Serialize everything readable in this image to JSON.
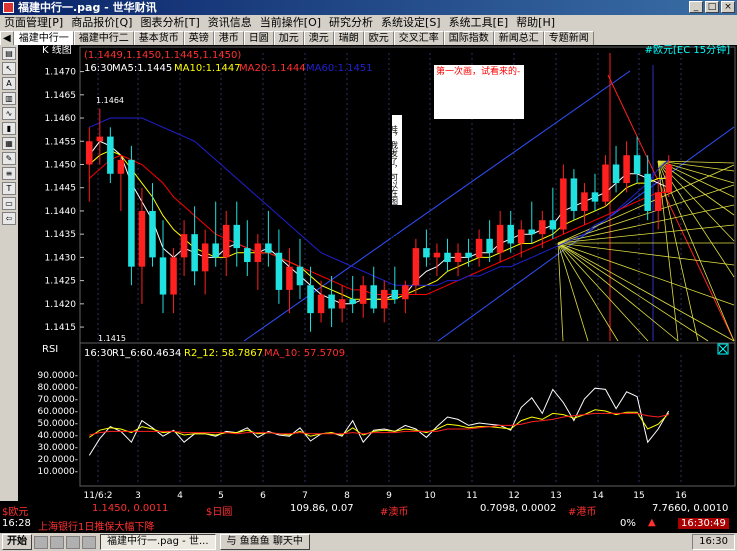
{
  "window": {
    "title": "福建中行一.pag - 世华财讯"
  },
  "menu": [
    "页面管理[P]",
    "商品报价[Q]",
    "图表分析[T]",
    "资讯信息",
    "当前操作[O]",
    "研究分析",
    "系统设定[S]",
    "系统工具[E]",
    "帮助[H]"
  ],
  "tabs": [
    "◀",
    "福建中行一",
    "福建中行二",
    "基本货币",
    "英镑",
    "港币",
    "日圆",
    "加元",
    "澳元",
    "瑞朗",
    "欧元",
    "交叉汇率",
    "国际指数",
    "新闻总汇",
    "专题新闻"
  ],
  "toolbar_icons": [
    "page-icon",
    "cursor-icon",
    "zoom-icon",
    "bar-chart-icon",
    "line-chart-icon",
    "candle-icon",
    "grid-icon",
    "pen-icon",
    "fib-icon",
    "text-icon",
    "print-icon",
    "exit-icon"
  ],
  "chart_data": [
    {
      "type": "candlestick",
      "title": "K 线图",
      "ohlc_header": "(1.1449,1.1450,1.1445,1.1450)",
      "time_label": "16:30",
      "ma_labels": [
        "MA5:1.1445",
        "MA10:1.1447",
        "MA20:1.1444",
        "MA60:1.1451"
      ],
      "symbol": "#欧元[EC 15分钟]",
      "annotations": [
        "1.1464",
        "1.1415",
        "第一次画，试看来的-",
        "哇，我发了，可以在图上画图也能写字..."
      ],
      "y_ticks": [
        "1.1470",
        "1.1465",
        "1.1460",
        "1.1455",
        "1.1450",
        "1.1445",
        "1.1440",
        "1.1435",
        "1.1430",
        "1.1425",
        "1.1420",
        "1.1415"
      ],
      "ylim": [
        1.1412,
        1.1474
      ],
      "x_ticks": [
        "11/6:2",
        "3",
        "4",
        "5",
        "6",
        "7",
        "8",
        "9",
        "10",
        "11",
        "12",
        "13",
        "14",
        "15",
        "16"
      ],
      "candles": [
        [
          1.145,
          1.1458,
          1.1442,
          1.1455
        ],
        [
          1.1455,
          1.1462,
          1.145,
          1.1456
        ],
        [
          1.1456,
          1.1458,
          1.1446,
          1.1448
        ],
        [
          1.1448,
          1.1452,
          1.144,
          1.1451
        ],
        [
          1.1451,
          1.1454,
          1.1424,
          1.1428
        ],
        [
          1.1428,
          1.1445,
          1.142,
          1.144
        ],
        [
          1.144,
          1.1446,
          1.1428,
          1.143
        ],
        [
          1.143,
          1.1438,
          1.1418,
          1.1422
        ],
        [
          1.1422,
          1.1432,
          1.1418,
          1.143
        ],
        [
          1.143,
          1.1438,
          1.1426,
          1.1435
        ],
        [
          1.1435,
          1.1441,
          1.1424,
          1.1427
        ],
        [
          1.1427,
          1.1436,
          1.1422,
          1.1433
        ],
        [
          1.1433,
          1.1442,
          1.1428,
          1.143
        ],
        [
          1.143,
          1.144,
          1.1426,
          1.1437
        ],
        [
          1.1437,
          1.1442,
          1.1428,
          1.1432
        ],
        [
          1.1432,
          1.1438,
          1.1426,
          1.1429
        ],
        [
          1.1429,
          1.1435,
          1.1423,
          1.1433
        ],
        [
          1.1433,
          1.144,
          1.1428,
          1.1431
        ],
        [
          1.1431,
          1.1436,
          1.142,
          1.1423
        ],
        [
          1.1423,
          1.1432,
          1.1418,
          1.1428
        ],
        [
          1.1428,
          1.1434,
          1.1421,
          1.1424
        ],
        [
          1.1424,
          1.1428,
          1.1414,
          1.1418
        ],
        [
          1.1418,
          1.1425,
          1.1416,
          1.1422
        ],
        [
          1.1422,
          1.1426,
          1.1415,
          1.1419
        ],
        [
          1.1419,
          1.1424,
          1.1416,
          1.1421
        ],
        [
          1.1421,
          1.1426,
          1.1418,
          1.142
        ],
        [
          1.142,
          1.1426,
          1.1417,
          1.1424
        ],
        [
          1.1424,
          1.1428,
          1.1418,
          1.1419
        ],
        [
          1.1419,
          1.1425,
          1.1416,
          1.1423
        ],
        [
          1.1423,
          1.1428,
          1.142,
          1.1421
        ],
        [
          1.1421,
          1.1425,
          1.1418,
          1.1424
        ],
        [
          1.1424,
          1.1434,
          1.1422,
          1.1432
        ],
        [
          1.1432,
          1.1436,
          1.1428,
          1.143
        ],
        [
          1.143,
          1.1433,
          1.1426,
          1.1431
        ],
        [
          1.1431,
          1.1434,
          1.1427,
          1.1429
        ],
        [
          1.1429,
          1.1433,
          1.1426,
          1.1431
        ],
        [
          1.1431,
          1.1434,
          1.1428,
          1.143
        ],
        [
          1.143,
          1.1436,
          1.1428,
          1.1434
        ],
        [
          1.1434,
          1.1438,
          1.1429,
          1.1431
        ],
        [
          1.1431,
          1.144,
          1.1429,
          1.1437
        ],
        [
          1.1437,
          1.144,
          1.1431,
          1.1433
        ],
        [
          1.1433,
          1.1438,
          1.143,
          1.1436
        ],
        [
          1.1436,
          1.1442,
          1.1433,
          1.1435
        ],
        [
          1.1435,
          1.144,
          1.1432,
          1.1438
        ],
        [
          1.1438,
          1.1445,
          1.1434,
          1.1436
        ],
        [
          1.1436,
          1.145,
          1.1435,
          1.1447
        ],
        [
          1.1447,
          1.1449,
          1.1438,
          1.144
        ],
        [
          1.144,
          1.1446,
          1.1437,
          1.1444
        ],
        [
          1.1444,
          1.1448,
          1.144,
          1.1442
        ],
        [
          1.1442,
          1.1452,
          1.1441,
          1.145
        ],
        [
          1.145,
          1.1454,
          1.1444,
          1.1446
        ],
        [
          1.1446,
          1.1455,
          1.1444,
          1.1452
        ],
        [
          1.1452,
          1.1456,
          1.1446,
          1.1448
        ],
        [
          1.1448,
          1.1452,
          1.1438,
          1.144
        ],
        [
          1.144,
          1.1446,
          1.1436,
          1.1444
        ],
        [
          1.1444,
          1.1452,
          1.1443,
          1.145
        ]
      ],
      "ma_series": [
        {
          "name": "MA5",
          "color": "#ffffff",
          "values": [
            1.1452,
            1.1455,
            1.1454,
            1.1452,
            1.1446,
            1.1442,
            1.1438,
            1.1432,
            1.143,
            1.1432,
            1.1431,
            1.143,
            1.143,
            1.1432,
            1.1433,
            1.1432,
            1.1431,
            1.1432,
            1.143,
            1.1428,
            1.1426,
            1.1424,
            1.1422,
            1.1421,
            1.142,
            1.142,
            1.1421,
            1.1421,
            1.1421,
            1.1422,
            1.1422,
            1.1425,
            1.1427,
            1.1428,
            1.143,
            1.143,
            1.143,
            1.1431,
            1.1431,
            1.1433,
            1.1434,
            1.1435,
            1.1435,
            1.1436,
            1.1437,
            1.144,
            1.1441,
            1.1442,
            1.1443,
            1.1444,
            1.1446,
            1.1448,
            1.1448,
            1.1447,
            1.1446,
            1.1445
          ]
        },
        {
          "name": "MA10",
          "color": "#ffff00",
          "values": [
            1.145,
            1.1452,
            1.1453,
            1.1452,
            1.1449,
            1.1446,
            1.1443,
            1.1439,
            1.1436,
            1.1434,
            1.1432,
            1.1431,
            1.143,
            1.143,
            1.1431,
            1.1431,
            1.1431,
            1.1431,
            1.143,
            1.1429,
            1.1428,
            1.1426,
            1.1424,
            1.1423,
            1.1422,
            1.1421,
            1.1421,
            1.1421,
            1.1421,
            1.1421,
            1.1422,
            1.1423,
            1.1424,
            1.1425,
            1.1427,
            1.1428,
            1.1429,
            1.143,
            1.143,
            1.1431,
            1.1432,
            1.1433,
            1.1433,
            1.1434,
            1.1435,
            1.1437,
            1.1438,
            1.1439,
            1.144,
            1.1441,
            1.1443,
            1.1445,
            1.1446,
            1.1446,
            1.1447,
            1.1447
          ]
        },
        {
          "name": "MA20",
          "color": "#ff0000",
          "values": [
            1.1447,
            1.1449,
            1.1451,
            1.1452,
            1.1451,
            1.145,
            1.1448,
            1.1446,
            1.1443,
            1.1441,
            1.1439,
            1.1437,
            1.1435,
            1.1434,
            1.1433,
            1.1432,
            1.1431,
            1.1431,
            1.143,
            1.1429,
            1.1428,
            1.1427,
            1.1426,
            1.1425,
            1.1424,
            1.1423,
            1.1423,
            1.1422,
            1.1422,
            1.1422,
            1.1422,
            1.1422,
            1.1422,
            1.1423,
            1.1424,
            1.1425,
            1.1426,
            1.1427,
            1.1428,
            1.1429,
            1.143,
            1.1431,
            1.1432,
            1.1433,
            1.1434,
            1.1435,
            1.1436,
            1.1437,
            1.1438,
            1.1439,
            1.144,
            1.1441,
            1.1442,
            1.1443,
            1.1444,
            1.1444
          ]
        },
        {
          "name": "MA60",
          "color": "#2020d0",
          "values": [
            1.1458,
            1.1459,
            1.146,
            1.146,
            1.146,
            1.146,
            1.1459,
            1.1458,
            1.1457,
            1.1456,
            1.1455,
            1.1453,
            1.1451,
            1.1449,
            1.1447,
            1.1445,
            1.1443,
            1.1441,
            1.1439,
            1.1437,
            1.1435,
            1.1433,
            1.1431,
            1.143,
            1.1429,
            1.1428,
            1.1427,
            1.1426,
            1.1425,
            1.1424,
            1.1424,
            1.1424,
            1.1424,
            1.1424,
            1.1425,
            1.1425,
            1.1426,
            1.1426,
            1.1427,
            1.1428,
            1.1428,
            1.1429,
            1.143,
            1.1431,
            1.1432,
            1.1433,
            1.1434,
            1.1435,
            1.1437,
            1.1438,
            1.144,
            1.1442,
            1.1444,
            1.1446,
            1.1449,
            1.1451
          ]
        }
      ]
    },
    {
      "type": "line",
      "title": "RSI",
      "time_label": "16:30",
      "labels": [
        "R1_6:60.4634",
        "R2_12: 58.7867",
        "MA_10: 57.5709"
      ],
      "y_ticks": [
        "90.0000-",
        "80.0000-",
        "70.0000-",
        "60.0000-",
        "50.0000-",
        "40.0000-",
        "30.0000-",
        "20.0000-",
        "10.0000-"
      ],
      "ylim": [
        0,
        100
      ],
      "series": [
        {
          "name": "R1_6",
          "color": "#ffffff",
          "values": [
            23,
            37,
            47,
            43,
            34,
            52,
            46,
            39,
            44,
            34,
            41,
            41,
            39,
            43,
            42,
            46,
            38,
            43,
            40,
            39,
            46,
            35,
            41,
            42,
            39,
            52,
            34,
            44,
            45,
            43,
            48,
            45,
            38,
            47,
            55,
            53,
            48,
            50,
            49,
            48,
            44,
            63,
            71,
            58,
            78,
            67,
            52,
            70,
            79,
            78,
            62,
            76,
            72,
            34,
            45,
            60
          ]
        },
        {
          "name": "R2_12",
          "color": "#ffff00",
          "values": [
            38,
            44,
            46,
            45,
            42,
            47,
            45,
            42,
            43,
            40,
            41,
            41,
            40,
            42,
            42,
            44,
            41,
            42,
            41,
            40,
            43,
            39,
            41,
            42,
            40,
            46,
            40,
            43,
            44,
            43,
            45,
            44,
            42,
            45,
            49,
            48,
            46,
            47,
            47,
            46,
            45,
            52,
            55,
            53,
            58,
            57,
            54,
            57,
            61,
            60,
            57,
            59,
            59,
            45,
            49,
            58
          ]
        },
        {
          "name": "MA_10",
          "color": "#ff2020",
          "values": [
            40,
            42,
            43,
            43,
            43,
            43,
            43,
            43,
            43,
            42,
            42,
            42,
            42,
            42,
            41,
            42,
            42,
            42,
            41,
            41,
            42,
            41,
            41,
            41,
            41,
            42,
            41,
            42,
            42,
            42,
            43,
            43,
            43,
            43,
            45,
            45,
            45,
            46,
            47,
            48,
            48,
            49,
            51,
            52,
            53,
            55,
            56,
            57,
            58,
            58,
            58,
            58,
            58,
            56,
            55,
            57
          ]
        }
      ]
    }
  ],
  "status": {
    "row1": [
      {
        "label": "$欧元",
        "value": "1.1450, 0.0011"
      },
      {
        "label": "$日圆",
        "value": "109.86, 0.07"
      },
      {
        "label": "#澳币",
        "value": "0.7098, 0.0002"
      },
      {
        "label": "#港币",
        "value": "7.7660, 0.0010"
      }
    ],
    "time_left": "16:28",
    "news": "上海银行1日推保大幅下降",
    "percent": "0%",
    "clock": "16:30:49"
  },
  "taskbar": {
    "start": "开始",
    "items": [
      "福建中行一.pag - 世...",
      "与 鱼鱼鱼 聊天中"
    ],
    "tray_time": "16:30"
  }
}
